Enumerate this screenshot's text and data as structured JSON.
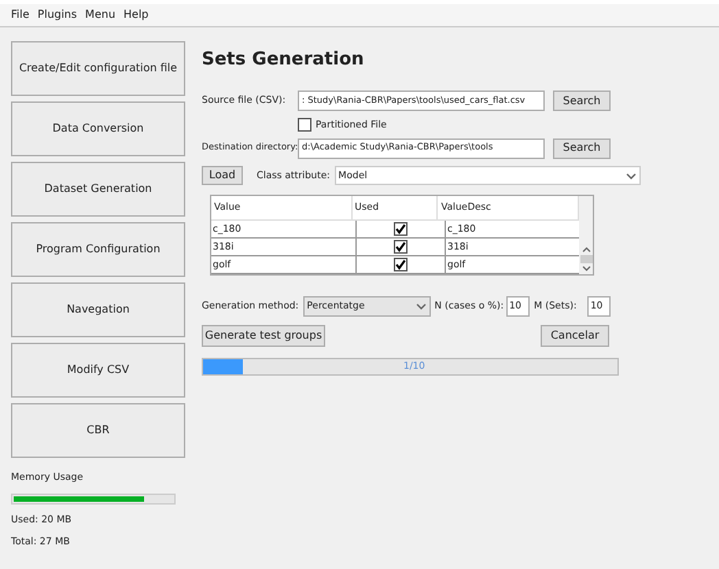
{
  "menu": [
    "File",
    "Plugins",
    "Menu",
    "Help"
  ],
  "sidebar": {
    "items": [
      "Create/Edit configuration file",
      "Data Conversion",
      "Dataset Generation",
      "Program Configuration",
      "Navegation",
      "Modify CSV",
      "CBR"
    ],
    "memory": {
      "label": "Memory Usage",
      "level": 0.82,
      "used": "Used: 20 MB",
      "total": "Total: 27 MB"
    }
  },
  "title": "Sets Generation",
  "source": {
    "label": "Source file (CSV):",
    "value": ": Study\\Rania-CBR\\Papers\\tools\\used_cars_flat.csv",
    "button": "Search"
  },
  "partitioned": {
    "label": "Partitioned File",
    "checked": false
  },
  "destination": {
    "label": "Destination directory:",
    "value": "d:\\Academic Study\\Rania-CBR\\Papers\\tools",
    "button": "Search"
  },
  "load_button": "Load",
  "class_attribute": {
    "label": "Class attribute:",
    "value": "Model"
  },
  "table": {
    "columns": [
      "Value",
      "Used",
      "ValueDesc"
    ],
    "rows": [
      {
        "value": "c_180",
        "used": true,
        "desc": "c_180"
      },
      {
        "value": "318i",
        "used": true,
        "desc": "318i"
      },
      {
        "value": "golf",
        "used": true,
        "desc": "golf"
      }
    ]
  },
  "generation": {
    "label": "Generation method:",
    "value": "Percentatge",
    "n_label": "N (cases o %):",
    "n_value": "10",
    "m_label": "M (Sets):",
    "m_value": "10"
  },
  "buttons": {
    "generate": "Generate test groups",
    "cancel": "Cancelar"
  },
  "progress": {
    "level": 0.095,
    "text": "1/10"
  }
}
